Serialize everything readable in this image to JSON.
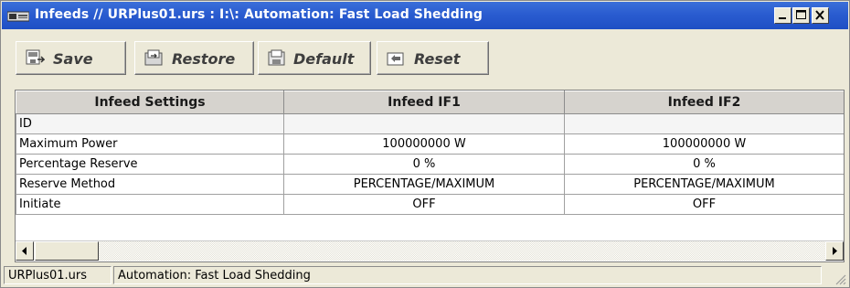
{
  "window": {
    "title": "Infeeds // URPlus01.urs : I:\\: Automation: Fast Load Shedding",
    "controls": [
      "minimize",
      "maximize",
      "close"
    ],
    "title_bar_color": "#2a5cd0"
  },
  "toolbar": {
    "save_label": "Save",
    "restore_label": "Restore",
    "default_label": "Default",
    "reset_label": "Reset"
  },
  "table": {
    "headers": [
      "Infeed Settings",
      "Infeed IF1",
      "Infeed IF2"
    ],
    "rows": [
      [
        "ID",
        "",
        ""
      ],
      [
        "Maximum Power",
        "100000000 W",
        "100000000 W"
      ],
      [
        "Percentage Reserve",
        "0 %",
        "0 %"
      ],
      [
        "Reserve Method",
        "PERCENTAGE/MAXIMUM",
        "PERCENTAGE/MAXIMUM"
      ],
      [
        "Initiate",
        "OFF",
        "OFF"
      ]
    ]
  },
  "status": {
    "file": "URPlus01.urs",
    "path": "Automation: Fast Load Shedding"
  }
}
